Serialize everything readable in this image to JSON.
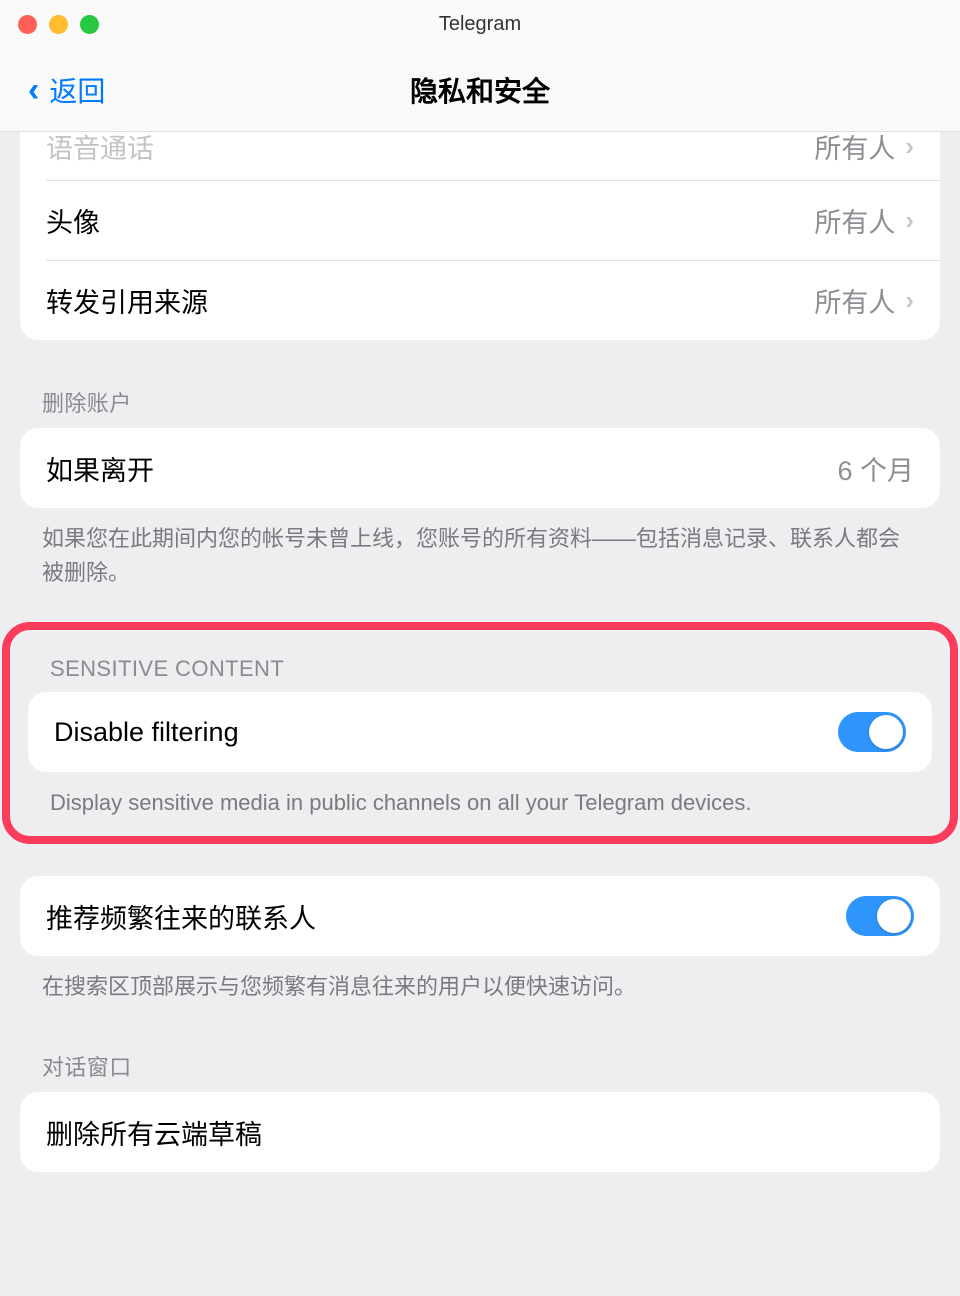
{
  "window": {
    "title": "Telegram"
  },
  "nav": {
    "back_label": "返回",
    "title": "隐私和安全"
  },
  "privacy_rows": [
    {
      "label": "语音通话",
      "value": "所有人"
    },
    {
      "label": "头像",
      "value": "所有人"
    },
    {
      "label": "转发引用来源",
      "value": "所有人"
    }
  ],
  "delete_account": {
    "header": "删除账户",
    "row_label": "如果离开",
    "row_value": "6 个月",
    "footer": "如果您在此期间内您的帐号未曾上线，您账号的所有资料——包括消息记录、联系人都会被删除。"
  },
  "sensitive": {
    "header": "SENSITIVE CONTENT",
    "row_label": "Disable filtering",
    "toggle_on": true,
    "footer": "Display sensitive media in public channels on all your Telegram devices."
  },
  "suggest": {
    "row_label": "推荐频繁往来的联系人",
    "toggle_on": true,
    "footer": "在搜索区顶部展示与您频繁有消息往来的用户以便快速访问。"
  },
  "chat_window": {
    "header": "对话窗口",
    "row_label": "删除所有云端草稿"
  }
}
